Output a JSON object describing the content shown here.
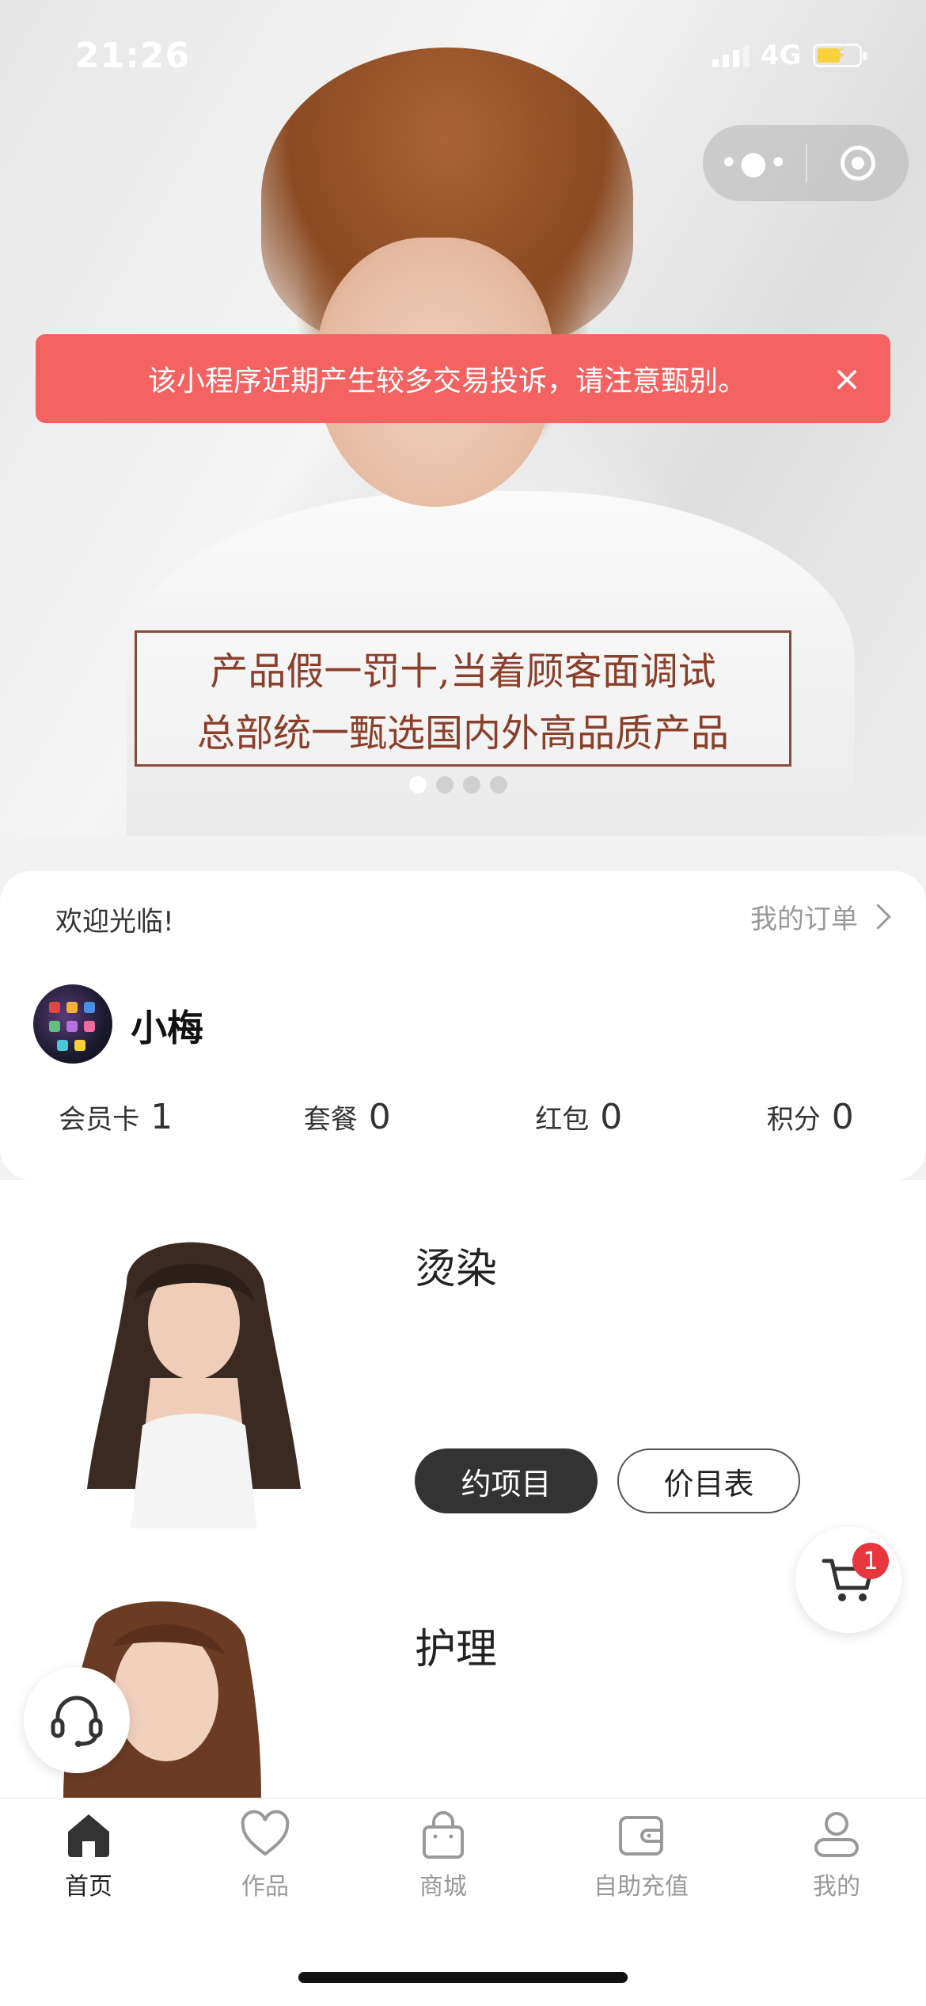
{
  "status_bar": {
    "time": "21:26",
    "network": "4G"
  },
  "warning": {
    "text": "该小程序近期产生较多交易投诉，请注意甄别。",
    "close_icon": "×"
  },
  "banner": {
    "slogan_line1": "产品假一罚十,当着顾客面调试",
    "slogan_line2": "总部统一甄选国内外高品质产品",
    "active_slide": 1,
    "slide_count": 4
  },
  "member": {
    "welcome": "欢迎光临!",
    "orders_link": "我的订单",
    "username": "小梅",
    "stats": [
      {
        "label": "会员卡",
        "value": "1"
      },
      {
        "label": "套餐",
        "value": "0"
      },
      {
        "label": "红包",
        "value": "0"
      },
      {
        "label": "积分",
        "value": "0"
      }
    ]
  },
  "services": [
    {
      "title": "烫染",
      "book_label": "约项目",
      "price_label": "价目表"
    },
    {
      "title": "护理"
    }
  ],
  "cart": {
    "count": "1"
  },
  "tabbar": [
    {
      "label": "首页",
      "icon": "home-icon",
      "active": true
    },
    {
      "label": "作品",
      "icon": "heart-icon",
      "active": false
    },
    {
      "label": "商城",
      "icon": "shopping-bag-icon",
      "active": false
    },
    {
      "label": "自助充值",
      "icon": "wallet-icon",
      "active": false
    },
    {
      "label": "我的",
      "icon": "user-icon",
      "active": false
    }
  ],
  "colors": {
    "warning_bg": "#f46262",
    "badge": "#e8363f",
    "dark_button": "#333333"
  }
}
